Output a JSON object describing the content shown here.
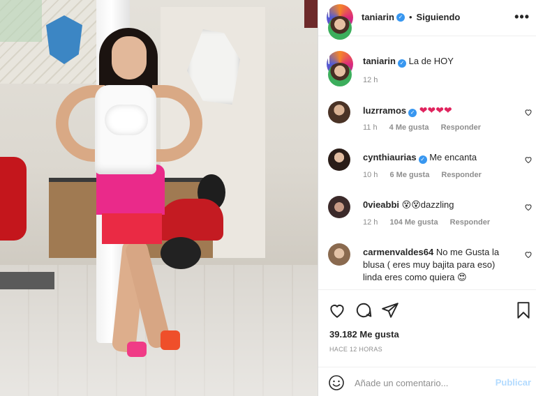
{
  "post": {
    "author": "taniarin",
    "follow_status": "Siguiendo",
    "caption": "La de HOY",
    "caption_time": "12 h"
  },
  "comments": [
    {
      "user": "luzrramos",
      "verified": true,
      "text": "❤❤❤❤",
      "time": "11 h",
      "likes": "4 Me gusta",
      "reply": "Responder"
    },
    {
      "user": "cynthiaurias",
      "verified": true,
      "text": "Me encanta",
      "time": "10 h",
      "likes": "6 Me gusta",
      "reply": "Responder"
    },
    {
      "user": "0vieabbi",
      "verified": false,
      "text": "😵😵dazzling",
      "time": "12 h",
      "likes": "104 Me gusta",
      "reply": "Responder"
    },
    {
      "user": "carmenvaldes64",
      "verified": false,
      "text": "No me Gusta la blusa ( eres muy bajita para eso) linda eres como quiera 😍"
    }
  ],
  "stats": {
    "likes": "39.182 Me gusta",
    "posted": "HACE 12 HORAS"
  },
  "composer": {
    "placeholder": "Añade un comentario...",
    "post_label": "Publicar"
  },
  "icons": {
    "more": "more-options-icon",
    "like": "heart-icon",
    "comment": "comment-icon",
    "share": "share-icon",
    "save": "bookmark-icon",
    "emoji": "emoji-icon",
    "verified": "verified-badge-icon"
  },
  "colors": {
    "verified": "#3897f0",
    "publish_disabled": "#b3dbff",
    "text": "#262626",
    "muted": "#8e8e8e"
  }
}
